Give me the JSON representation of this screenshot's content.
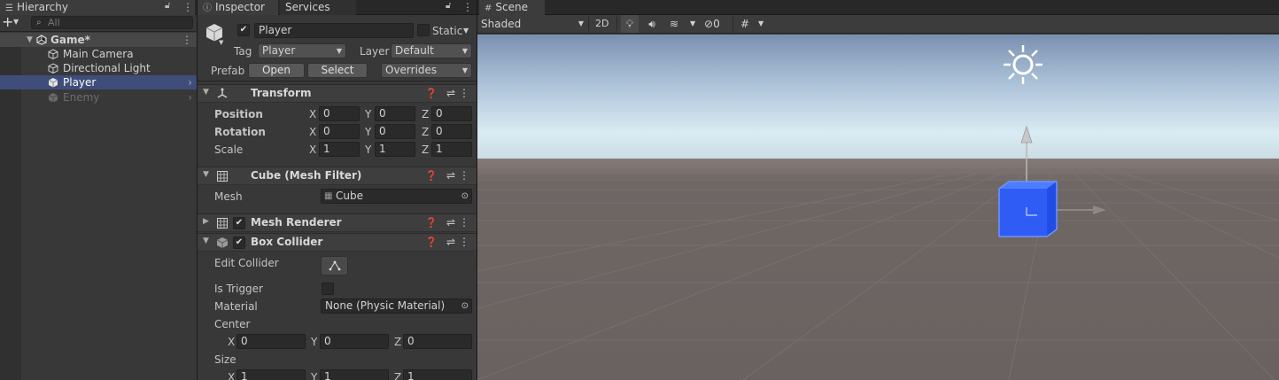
{
  "hierarchy": {
    "tab_label": "Hierarchy",
    "search_placeholder": "All",
    "items": [
      {
        "label": "Game*"
      },
      {
        "label": "Main Camera"
      },
      {
        "label": "Directional Light"
      },
      {
        "label": "Player"
      },
      {
        "label": "Enemy"
      }
    ]
  },
  "inspector": {
    "tabs": [
      {
        "label": "Inspector"
      },
      {
        "label": "Services"
      }
    ],
    "object": {
      "name": "Player",
      "static_label": "Static",
      "tag_label": "Tag",
      "tag_value": "Player",
      "layer_label": "Layer",
      "layer_value": "Default",
      "prefab_label": "Prefab",
      "open_label": "Open",
      "select_label": "Select",
      "overrides_label": "Overrides"
    },
    "transform": {
      "title": "Transform",
      "rows": [
        {
          "label": "Position",
          "x": "0",
          "y": "0",
          "z": "0"
        },
        {
          "label": "Rotation",
          "x": "0",
          "y": "0",
          "z": "0"
        },
        {
          "label": "Scale",
          "x": "1",
          "y": "1",
          "z": "1"
        }
      ],
      "axis_x": "X",
      "axis_y": "Y",
      "axis_z": "Z"
    },
    "mesh_filter": {
      "title": "Cube (Mesh Filter)",
      "mesh_label": "Mesh",
      "mesh_value": "Cube"
    },
    "mesh_renderer": {
      "title": "Mesh Renderer"
    },
    "box_collider": {
      "title": "Box Collider",
      "edit_collider_label": "Edit Collider",
      "is_trigger_label": "Is Trigger",
      "material_label": "Material",
      "material_value": "None (Physic Material)",
      "center_label": "Center",
      "center": {
        "x": "0",
        "y": "0",
        "z": "0"
      },
      "size_label": "Size",
      "size": {
        "x": "1",
        "y": "1",
        "z": "1"
      }
    }
  },
  "scene": {
    "tab_label": "Scene",
    "shading_mode": "Shaded",
    "mode_2d": "2D",
    "hidden_count": "0"
  },
  "colors": {
    "selection": "#3e4d7a",
    "cube_blue": "#2f5cf5",
    "sky_top": "#7d93b3",
    "horizon": "#d6e6f0",
    "ground": "#6e6663"
  }
}
